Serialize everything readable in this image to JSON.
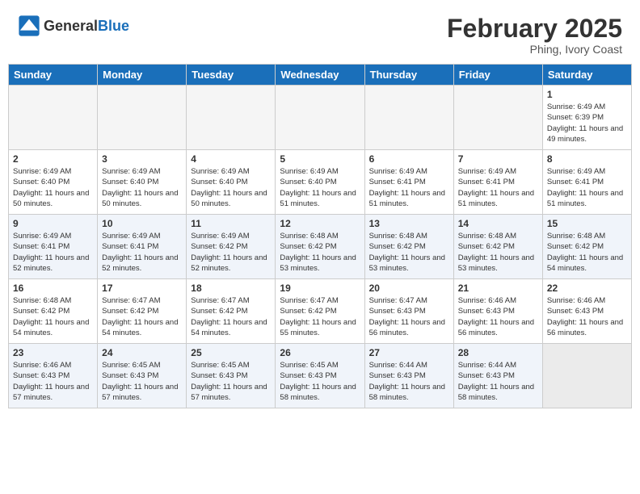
{
  "header": {
    "logo_general": "General",
    "logo_blue": "Blue",
    "month_title": "February 2025",
    "subtitle": "Phing, Ivory Coast"
  },
  "days_of_week": [
    "Sunday",
    "Monday",
    "Tuesday",
    "Wednesday",
    "Thursday",
    "Friday",
    "Saturday"
  ],
  "weeks": [
    {
      "shade": false,
      "days": [
        {
          "num": "",
          "info": ""
        },
        {
          "num": "",
          "info": ""
        },
        {
          "num": "",
          "info": ""
        },
        {
          "num": "",
          "info": ""
        },
        {
          "num": "",
          "info": ""
        },
        {
          "num": "",
          "info": ""
        },
        {
          "num": "1",
          "info": "Sunrise: 6:49 AM\nSunset: 6:39 PM\nDaylight: 11 hours and 49 minutes."
        }
      ]
    },
    {
      "shade": false,
      "days": [
        {
          "num": "2",
          "info": "Sunrise: 6:49 AM\nSunset: 6:40 PM\nDaylight: 11 hours and 50 minutes."
        },
        {
          "num": "3",
          "info": "Sunrise: 6:49 AM\nSunset: 6:40 PM\nDaylight: 11 hours and 50 minutes."
        },
        {
          "num": "4",
          "info": "Sunrise: 6:49 AM\nSunset: 6:40 PM\nDaylight: 11 hours and 50 minutes."
        },
        {
          "num": "5",
          "info": "Sunrise: 6:49 AM\nSunset: 6:40 PM\nDaylight: 11 hours and 51 minutes."
        },
        {
          "num": "6",
          "info": "Sunrise: 6:49 AM\nSunset: 6:41 PM\nDaylight: 11 hours and 51 minutes."
        },
        {
          "num": "7",
          "info": "Sunrise: 6:49 AM\nSunset: 6:41 PM\nDaylight: 11 hours and 51 minutes."
        },
        {
          "num": "8",
          "info": "Sunrise: 6:49 AM\nSunset: 6:41 PM\nDaylight: 11 hours and 51 minutes."
        }
      ]
    },
    {
      "shade": true,
      "days": [
        {
          "num": "9",
          "info": "Sunrise: 6:49 AM\nSunset: 6:41 PM\nDaylight: 11 hours and 52 minutes."
        },
        {
          "num": "10",
          "info": "Sunrise: 6:49 AM\nSunset: 6:41 PM\nDaylight: 11 hours and 52 minutes."
        },
        {
          "num": "11",
          "info": "Sunrise: 6:49 AM\nSunset: 6:42 PM\nDaylight: 11 hours and 52 minutes."
        },
        {
          "num": "12",
          "info": "Sunrise: 6:48 AM\nSunset: 6:42 PM\nDaylight: 11 hours and 53 minutes."
        },
        {
          "num": "13",
          "info": "Sunrise: 6:48 AM\nSunset: 6:42 PM\nDaylight: 11 hours and 53 minutes."
        },
        {
          "num": "14",
          "info": "Sunrise: 6:48 AM\nSunset: 6:42 PM\nDaylight: 11 hours and 53 minutes."
        },
        {
          "num": "15",
          "info": "Sunrise: 6:48 AM\nSunset: 6:42 PM\nDaylight: 11 hours and 54 minutes."
        }
      ]
    },
    {
      "shade": false,
      "days": [
        {
          "num": "16",
          "info": "Sunrise: 6:48 AM\nSunset: 6:42 PM\nDaylight: 11 hours and 54 minutes."
        },
        {
          "num": "17",
          "info": "Sunrise: 6:47 AM\nSunset: 6:42 PM\nDaylight: 11 hours and 54 minutes."
        },
        {
          "num": "18",
          "info": "Sunrise: 6:47 AM\nSunset: 6:42 PM\nDaylight: 11 hours and 54 minutes."
        },
        {
          "num": "19",
          "info": "Sunrise: 6:47 AM\nSunset: 6:42 PM\nDaylight: 11 hours and 55 minutes."
        },
        {
          "num": "20",
          "info": "Sunrise: 6:47 AM\nSunset: 6:43 PM\nDaylight: 11 hours and 56 minutes."
        },
        {
          "num": "21",
          "info": "Sunrise: 6:46 AM\nSunset: 6:43 PM\nDaylight: 11 hours and 56 minutes."
        },
        {
          "num": "22",
          "info": "Sunrise: 6:46 AM\nSunset: 6:43 PM\nDaylight: 11 hours and 56 minutes."
        }
      ]
    },
    {
      "shade": true,
      "days": [
        {
          "num": "23",
          "info": "Sunrise: 6:46 AM\nSunset: 6:43 PM\nDaylight: 11 hours and 57 minutes."
        },
        {
          "num": "24",
          "info": "Sunrise: 6:45 AM\nSunset: 6:43 PM\nDaylight: 11 hours and 57 minutes."
        },
        {
          "num": "25",
          "info": "Sunrise: 6:45 AM\nSunset: 6:43 PM\nDaylight: 11 hours and 57 minutes."
        },
        {
          "num": "26",
          "info": "Sunrise: 6:45 AM\nSunset: 6:43 PM\nDaylight: 11 hours and 58 minutes."
        },
        {
          "num": "27",
          "info": "Sunrise: 6:44 AM\nSunset: 6:43 PM\nDaylight: 11 hours and 58 minutes."
        },
        {
          "num": "28",
          "info": "Sunrise: 6:44 AM\nSunset: 6:43 PM\nDaylight: 11 hours and 58 minutes."
        },
        {
          "num": "",
          "info": ""
        }
      ]
    }
  ]
}
